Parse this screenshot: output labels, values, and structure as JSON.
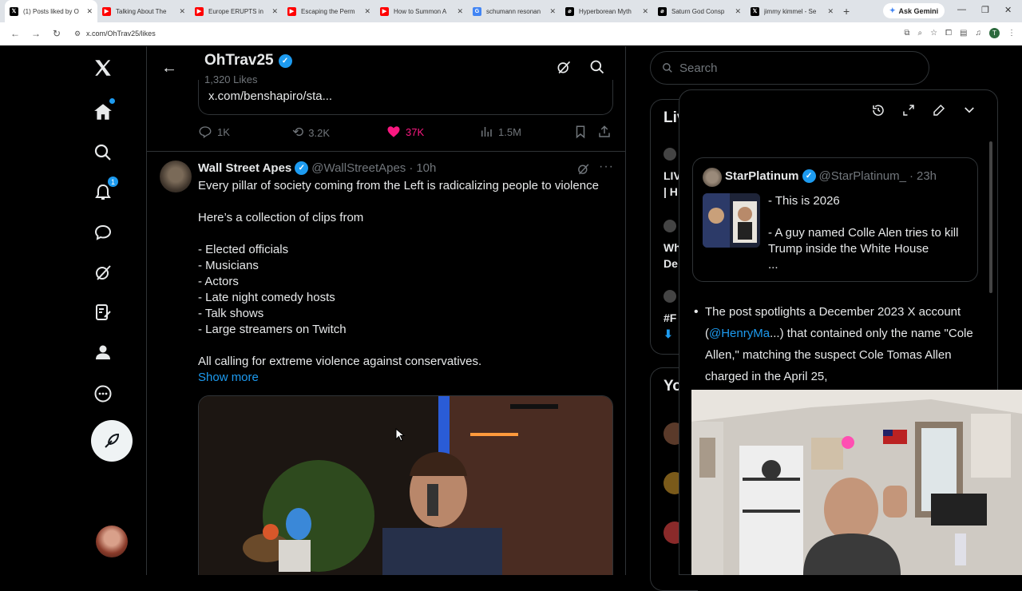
{
  "browser": {
    "tabs": [
      {
        "title": "(1) Posts liked by O",
        "icon": "x-icon",
        "color": "#000000",
        "active": true
      },
      {
        "title": "Talking About The",
        "icon": "youtube-icon",
        "color": "#ff0000"
      },
      {
        "title": "Europe ERUPTS in",
        "icon": "youtube-icon",
        "color": "#ff0000"
      },
      {
        "title": "Escaping the Perm",
        "icon": "youtube-icon",
        "color": "#ff0000"
      },
      {
        "title": "How to Summon A",
        "icon": "youtube-icon",
        "color": "#ff0000"
      },
      {
        "title": "schumann resonan",
        "icon": "google-icon",
        "color": "#4285f4"
      },
      {
        "title": "Hyperborean Myth",
        "icon": "grok-icon",
        "color": "#000000"
      },
      {
        "title": "Saturn God Consp",
        "icon": "grok-icon",
        "color": "#000000"
      },
      {
        "title": "jimmy kimmel - Se",
        "icon": "x-icon",
        "color": "#000000"
      }
    ],
    "new_tab": "+",
    "gemini_label": "Ask Gemini",
    "url": "x.com/OhTrav25/likes",
    "profile_initial": "T"
  },
  "profile": {
    "name": "OhTrav25",
    "likes_count": "1,320 Likes"
  },
  "nav": {
    "notifications_badge": "1"
  },
  "prev_post": {
    "quote_link": "x.com/benshapiro/sta...",
    "replies": "1K",
    "reposts": "3.2K",
    "likes": "37K",
    "views": "1.5M"
  },
  "post": {
    "name": "Wall Street Apes",
    "handle": "@WallStreetApes",
    "separator": "·",
    "time": "10h",
    "line1": "Every pillar of society coming from the Left is radicalizing people to violence",
    "line2": "Here’s a collection of clips from",
    "list": [
      "- Elected officials",
      "- Musicians",
      "- Actors",
      "- Late night comedy hosts",
      "- Talk shows",
      "- Large streamers on Twitch"
    ],
    "line3": "All calling for extreme violence against conservatives.",
    "show_more": "Show more"
  },
  "search": {
    "placeholder": "Search"
  },
  "right_column": {
    "live_title": "Liv",
    "live_item1a": "LIV",
    "live_item1b": "| H",
    "wh_item_a": "Wh",
    "wh_item_b": "De",
    "hash_item": "#F",
    "you_title": "Yo"
  },
  "grok": {
    "quoted": {
      "name": "StarPlatinum",
      "handle": "@StarPlatinum_",
      "separator": "·",
      "time": "23h",
      "line1": "- This is 2026",
      "line2": "- A guy named Colle Alen tries to kill Trump inside the White House",
      "ellipsis": "..."
    },
    "bullet": "•",
    "answer_before": "The post spotlights a December 2023 X account (",
    "answer_mention": "@HenryMa",
    "answer_after": "...) that contained only the name \"Cole Allen,\" matching the suspect Cole Tomas Allen charged in the April 25,"
  },
  "colors": {
    "accent": "#1d9bf0",
    "like": "#f91880",
    "muted": "#71767b",
    "border": "#2f3336"
  }
}
